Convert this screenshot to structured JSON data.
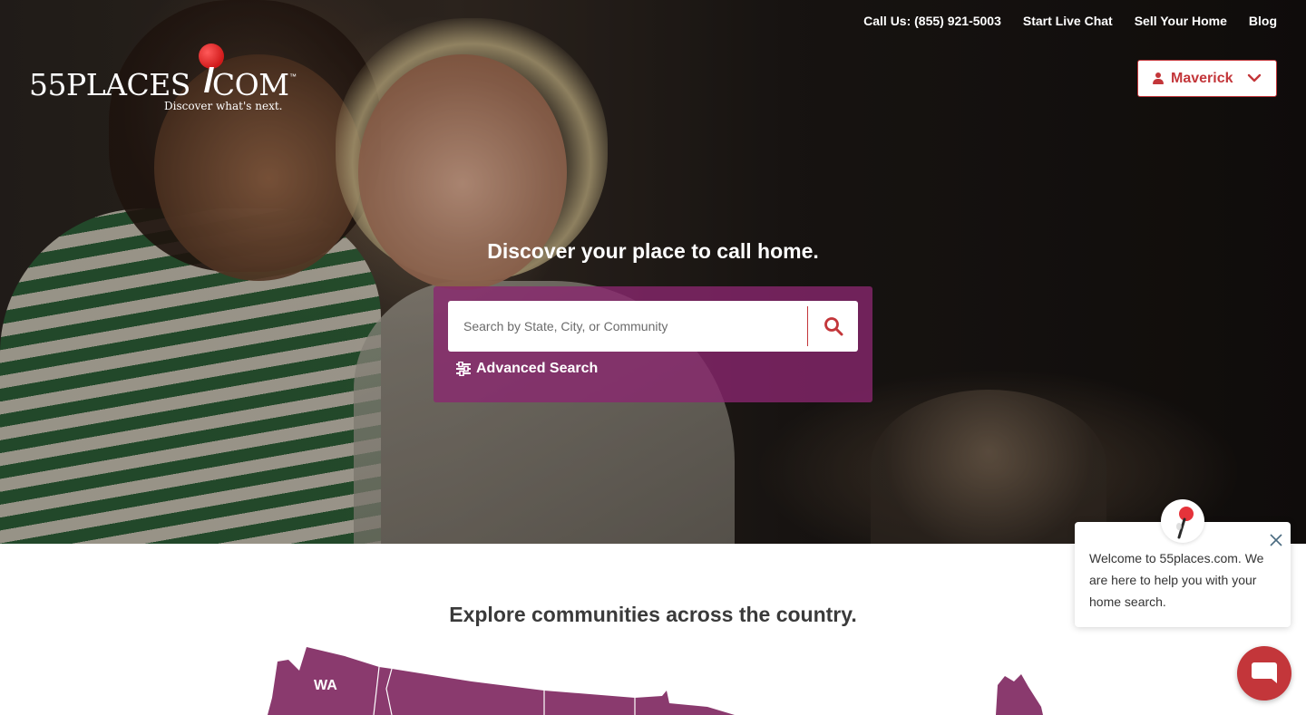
{
  "brand": {
    "logo_text": "55PLACES",
    "logo_suffix": "COM",
    "tagline": "Discover what's next.",
    "trademark": "™",
    "accent_color": "#c3363a",
    "purple_color": "#8a2670"
  },
  "top_nav": {
    "call_label": "Call Us: (855) 921-5003",
    "chat_label": "Start Live Chat",
    "sell_label": "Sell Your Home",
    "blog_label": "Blog"
  },
  "user_menu": {
    "name": "Maverick",
    "icon": "user-icon",
    "chevron_icon": "chevron-down-icon"
  },
  "hero": {
    "headline": "Discover your place to call home.",
    "search": {
      "placeholder": "Search by State, City, or Community",
      "value": "",
      "button_icon": "search-icon"
    },
    "advanced_search_label": "Advanced Search",
    "advanced_search_icon": "sliders-icon"
  },
  "explore": {
    "title": "Explore communities across the country.",
    "map_labels": [
      "WA"
    ]
  },
  "chat": {
    "message": "Welcome to 55places.com. We are here to help you with your home search.",
    "close_icon": "close-icon",
    "avatar_icon": "map-pin-icon",
    "launcher_icon": "chat-bubble-icon"
  }
}
